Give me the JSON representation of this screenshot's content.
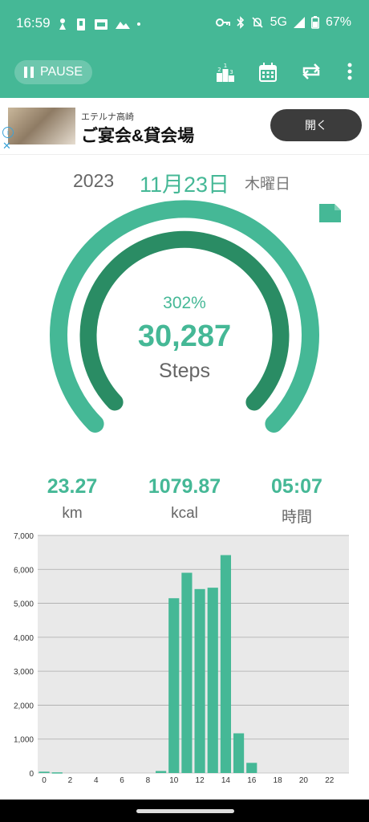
{
  "status_bar": {
    "time": "16:59",
    "network": "5G",
    "battery": "67%"
  },
  "toolbar": {
    "pause_label": "PAUSE"
  },
  "ad": {
    "subtitle": "エテルナ高崎",
    "title": "ご宴会&貸会場",
    "open_label": "開く",
    "info_glyph": "i",
    "close_glyph": "✕"
  },
  "date": {
    "year": "2023",
    "day": "11月23日",
    "weekday": "木曜日"
  },
  "gauge": {
    "percent": "302%",
    "steps": "30,287",
    "steps_label": "Steps",
    "progress_fraction": 1.0
  },
  "stats": {
    "distance": "23.27",
    "distance_unit": "km",
    "calories": "1079.87",
    "calories_unit": "kcal",
    "duration": "05:07",
    "duration_unit": "時間"
  },
  "colors": {
    "accent": "#45b896",
    "accent_dark": "#2a8c64"
  },
  "chart_data": {
    "type": "bar",
    "x": [
      0,
      1,
      2,
      3,
      4,
      5,
      6,
      7,
      8,
      9,
      10,
      11,
      12,
      13,
      14,
      15,
      16,
      17,
      18,
      19,
      20,
      21,
      22,
      23
    ],
    "values": [
      40,
      20,
      0,
      0,
      0,
      0,
      0,
      0,
      0,
      60,
      5150,
      5900,
      5420,
      5460,
      6420,
      1170,
      300,
      0,
      0,
      0,
      0,
      0,
      0,
      0
    ],
    "ylim": [
      0,
      7000
    ],
    "yticks": [
      "0",
      "1,000",
      "2,000",
      "3,000",
      "4,000",
      "5,000",
      "6,000",
      "7,000"
    ],
    "xticks": [
      "0",
      "2",
      "4",
      "6",
      "8",
      "10",
      "12",
      "14",
      "16",
      "18",
      "20",
      "22"
    ],
    "grid": true
  }
}
